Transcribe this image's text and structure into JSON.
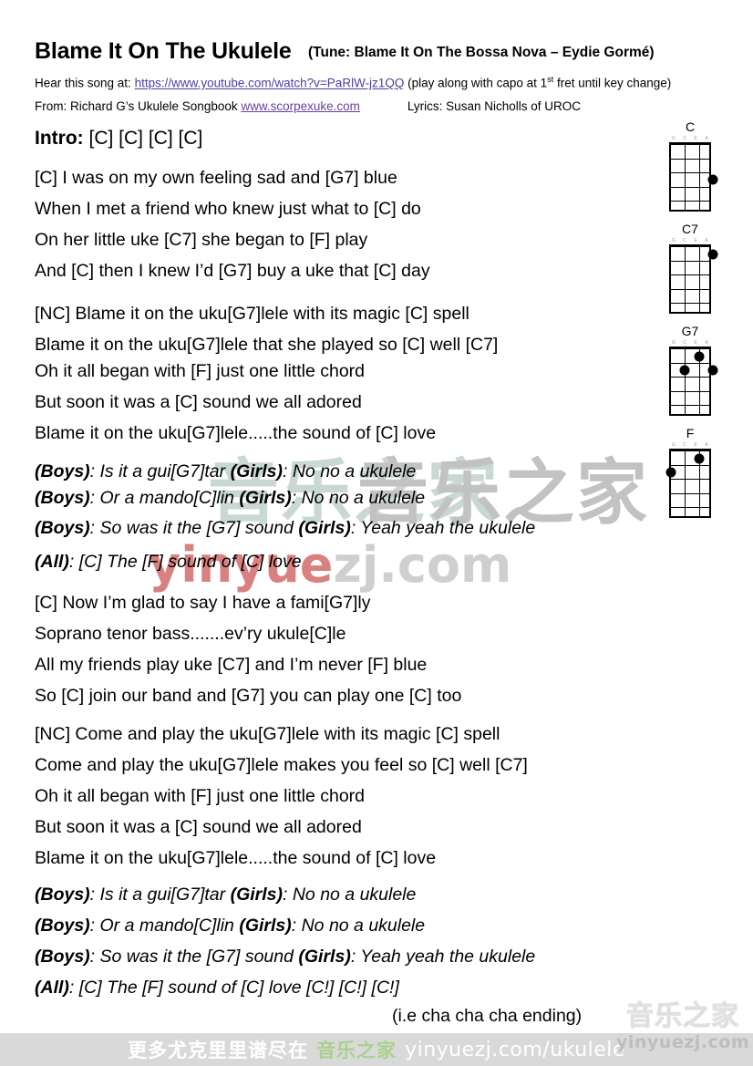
{
  "header": {
    "title": "Blame It On The Ukulele",
    "tune": "(Tune: Blame It On The Bossa Nova – Eydie Gormé)",
    "hear_label": "Hear this song at:",
    "youtube_url": "https://www.youtube.com/watch?v=PaRlW-jz1QQ",
    "capo_note_pre": "(play along with capo at 1",
    "capo_note_sup": "st",
    "capo_note_post": " fret until key change)",
    "from_label": "From:  Richard G’s Ukulele Songbook",
    "site_url": "www.scorpexuke.com",
    "lyrics_credit": "Lyrics:  Susan Nicholls of UROC"
  },
  "intro": {
    "label": "Intro:",
    "chords": "[C] [C] [C] [C]"
  },
  "verse1": [
    "[C] I was on my own feeling sad and [G7] blue",
    "When I met a friend who knew just what to [C] do",
    "On her little uke [C7] she began to [F] play",
    "And [C] then I knew I’d [G7] buy a uke that [C] day"
  ],
  "chorus1": [
    "[NC] Blame it on the uku[G7]lele with its magic [C] spell",
    "Blame it on the uku[G7]lele that she played so [C] well [C7]",
    "Oh it all began with [F] just one little chord",
    "But soon it was a [C] sound we all adored",
    "Blame it on the uku[G7]lele.....the sound of [C] love"
  ],
  "callresponse1": [
    {
      "role1": "(Boys)",
      "text1": ":  Is it a gui[G7]tar",
      "role2": "(Girls)",
      "text2": ":  No no a ukulele"
    },
    {
      "role1": "(Boys)",
      "text1": ":  Or a mando[C]lin",
      "role2": "(Girls)",
      "text2": ":  No no a ukulele"
    },
    {
      "role1": "(Boys)",
      "text1": ":  So was it the [G7] sound",
      "role2": "(Girls)",
      "text2": ":  Yeah yeah the ukulele"
    },
    {
      "role1": "(All)",
      "text1": ":    [C] The [F] sound of [C] love",
      "role2": "",
      "text2": ""
    }
  ],
  "verse2": [
    "[C] Now I’m glad to say I have a fami[G7]ly",
    "Soprano tenor bass.......ev’ry ukule[C]le",
    "All my friends play uke [C7] and I’m never [F] blue",
    "So [C] join our band and [G7] you can play one [C] too"
  ],
  "chorus2": [
    "[NC] Come and play the uku[G7]lele with its magic [C] spell",
    "Come and play the uku[G7]lele makes you feel so [C] well [C7]",
    "Oh it all began with [F] just one little chord",
    "But soon it was a [C] sound we all adored",
    "Blame it on the uku[G7]lele.....the sound of [C] love"
  ],
  "callresponse2": [
    {
      "role1": "(Boys)",
      "text1": ":  Is it a gui[G7]tar",
      "role2": "(Girls)",
      "text2": ":  No no a ukulele"
    },
    {
      "role1": "(Boys)",
      "text1": ":  Or a mando[C]lin",
      "role2": "(Girls)",
      "text2": ":  No no a ukulele"
    },
    {
      "role1": "(Boys)",
      "text1": ":  So was it the [G7] sound",
      "role2": "(Girls)",
      "text2": ":  Yeah yeah the ukulele"
    },
    {
      "role1": "(All)",
      "text1": ":   [C] The [F] sound of [C] love [C!] [C!] [C!]",
      "role2": "",
      "text2": ""
    }
  ],
  "ending_note": "(i.e cha cha cha ending)",
  "chord_diagrams": [
    {
      "name": "C",
      "strings": [
        "G",
        "C",
        "E",
        "A"
      ],
      "dots": [
        {
          "string": 4,
          "fret": 3
        }
      ]
    },
    {
      "name": "C7",
      "strings": [
        "G",
        "C",
        "E",
        "A"
      ],
      "dots": [
        {
          "string": 4,
          "fret": 1
        }
      ]
    },
    {
      "name": "G7",
      "strings": [
        "G",
        "C",
        "E",
        "A"
      ],
      "dots": [
        {
          "string": 3,
          "fret": 1
        },
        {
          "string": 2,
          "fret": 2
        },
        {
          "string": 4,
          "fret": 2
        }
      ]
    },
    {
      "name": "F",
      "strings": [
        "G",
        "C",
        "E",
        "A"
      ],
      "dots": [
        {
          "string": 3,
          "fret": 1
        },
        {
          "string": 1,
          "fret": 2
        }
      ]
    }
  ],
  "watermarks": {
    "cn_top": "音乐之家",
    "en_mid": "yinyuezj.com"
  },
  "banner": {
    "cn_text": "更多尤克里里谱尽在",
    "cn_brand": "音乐之家",
    "url": "yinyuezj.com/ukulele"
  },
  "logo": {
    "cn": "音乐之家",
    "url": "yinyuezj.com"
  }
}
